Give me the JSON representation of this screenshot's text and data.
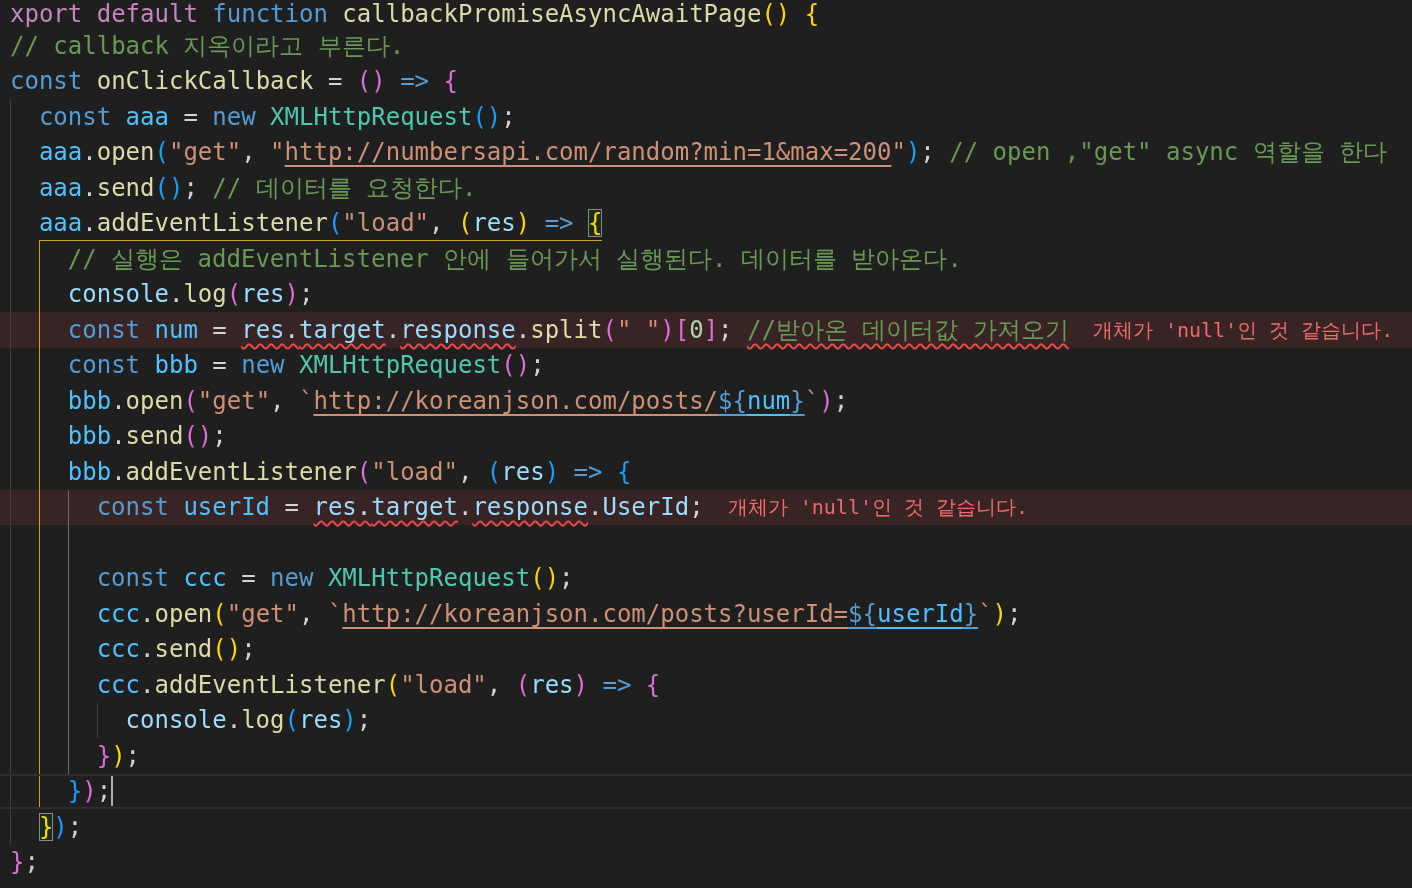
{
  "editor": {
    "lines": [
      {
        "kind": "code",
        "current": false,
        "error": false,
        "tokens": [
          {
            "text": "xport default ",
            "kind": "control"
          },
          {
            "text": "function ",
            "kind": "keyword"
          },
          {
            "text": "callbackPromiseAsyncAwaitPage",
            "kind": "function"
          },
          {
            "text": "() ",
            "kind": "bracket",
            "color": "#ffd700"
          },
          {
            "text": "{",
            "kind": "bracket",
            "color": "#ffd700"
          }
        ]
      },
      {
        "kind": "code",
        "current": false,
        "error": false,
        "tokens": [
          {
            "text": "// callback 지옥이라고 부른다.",
            "kind": "comment"
          }
        ]
      },
      {
        "kind": "code",
        "current": false,
        "error": false,
        "active_guide": false,
        "bracket_guide": false,
        "tokens": [
          {
            "text": "const ",
            "kind": "keyword"
          },
          {
            "text": "onClickCallback",
            "kind": "function"
          },
          {
            "text": " = ",
            "kind": "plain"
          },
          {
            "text": "() ",
            "kind": "bracket",
            "color": "#da70d6"
          },
          {
            "text": "=> ",
            "kind": "keyword"
          },
          {
            "text": "{",
            "kind": "bracket",
            "color": "#da70d6"
          }
        ],
        "children": [
          {
            "kind": "code",
            "current": false,
            "error": false,
            "tokens": [
              {
                "text": "const ",
                "kind": "keyword"
              },
              {
                "text": "aaa",
                "kind": "constant"
              },
              {
                "text": " = ",
                "kind": "plain"
              },
              {
                "text": "new ",
                "kind": "keyword"
              },
              {
                "text": "XMLHttpRequest",
                "kind": "class"
              },
              {
                "text": "()",
                "kind": "bracket",
                "color": "#179fff"
              },
              {
                "text": ";",
                "kind": "plain"
              }
            ]
          },
          {
            "kind": "code",
            "current": false,
            "error": false,
            "tokens": [
              {
                "text": "aaa",
                "kind": "constant"
              },
              {
                "text": ".",
                "kind": "plain"
              },
              {
                "text": "open",
                "kind": "function"
              },
              {
                "text": "(",
                "kind": "bracket",
                "color": "#179fff"
              },
              {
                "text": "\"get\"",
                "kind": "string"
              },
              {
                "text": ", ",
                "kind": "plain"
              },
              {
                "text": "\"",
                "kind": "string"
              },
              {
                "text": "http://numbersapi.com/random?min=1&max=200",
                "kind": "string",
                "link": true
              },
              {
                "text": "\"",
                "kind": "string"
              },
              {
                "text": ")",
                "kind": "bracket",
                "color": "#179fff"
              },
              {
                "text": "; ",
                "kind": "plain"
              },
              {
                "text": "// open ,\"get\" async 역할을 한다",
                "kind": "comment"
              }
            ]
          },
          {
            "kind": "code",
            "current": false,
            "error": false,
            "tokens": [
              {
                "text": "aaa",
                "kind": "constant"
              },
              {
                "text": ".",
                "kind": "plain"
              },
              {
                "text": "send",
                "kind": "function"
              },
              {
                "text": "()",
                "kind": "bracket",
                "color": "#179fff"
              },
              {
                "text": "; ",
                "kind": "plain"
              },
              {
                "text": "// 데이터를 요청한다.",
                "kind": "comment"
              }
            ]
          },
          {
            "kind": "code",
            "current": false,
            "error": false,
            "active_guide": false,
            "bracket_guide": true,
            "tokens": [
              {
                "text": "aaa",
                "kind": "constant"
              },
              {
                "text": ".",
                "kind": "plain"
              },
              {
                "text": "addEventListener",
                "kind": "function"
              },
              {
                "text": "(",
                "kind": "bracket",
                "color": "#179fff"
              },
              {
                "text": "\"load\"",
                "kind": "string"
              },
              {
                "text": ", ",
                "kind": "plain"
              },
              {
                "text": "(",
                "kind": "bracket",
                "color": "#ffd700"
              },
              {
                "text": "res",
                "kind": "variable"
              },
              {
                "text": ") ",
                "kind": "bracket",
                "color": "#ffd700"
              },
              {
                "text": "=> ",
                "kind": "keyword"
              },
              {
                "text": "{",
                "kind": "bracket",
                "color": "#ffd700",
                "matched": true
              }
            ],
            "children": [
              {
                "kind": "code",
                "current": false,
                "error": false,
                "tokens": [
                  {
                    "text": "// 실행은 addEventListener 안에 들어가서 실행된다. 데이터를 받아온다.",
                    "kind": "comment"
                  }
                ]
              },
              {
                "kind": "code",
                "current": false,
                "error": false,
                "tokens": [
                  {
                    "text": "console",
                    "kind": "variable"
                  },
                  {
                    "text": ".",
                    "kind": "plain"
                  },
                  {
                    "text": "log",
                    "kind": "function"
                  },
                  {
                    "text": "(",
                    "kind": "bracket",
                    "color": "#da70d6"
                  },
                  {
                    "text": "res",
                    "kind": "variable"
                  },
                  {
                    "text": ")",
                    "kind": "bracket",
                    "color": "#da70d6"
                  },
                  {
                    "text": ";",
                    "kind": "plain"
                  }
                ]
              },
              {
                "kind": "code",
                "current": false,
                "error": true,
                "message": "개체가 'null'인 것 같습니다.",
                "tokens": [
                  {
                    "text": "const ",
                    "kind": "keyword"
                  },
                  {
                    "text": "num",
                    "kind": "constant"
                  },
                  {
                    "text": " = ",
                    "kind": "plain"
                  },
                  {
                    "text": "res",
                    "kind": "variable",
                    "squiggle": true
                  },
                  {
                    "text": ".",
                    "kind": "plain",
                    "squiggle": true
                  },
                  {
                    "text": "target",
                    "kind": "variable",
                    "squiggle": true
                  },
                  {
                    "text": ".",
                    "kind": "plain"
                  },
                  {
                    "text": "response",
                    "kind": "variable",
                    "squiggle": true
                  },
                  {
                    "text": ".",
                    "kind": "plain"
                  },
                  {
                    "text": "split",
                    "kind": "function"
                  },
                  {
                    "text": "(",
                    "kind": "bracket",
                    "color": "#da70d6"
                  },
                  {
                    "text": "\" \"",
                    "kind": "string"
                  },
                  {
                    "text": ")",
                    "kind": "bracket",
                    "color": "#da70d6"
                  },
                  {
                    "text": "[",
                    "kind": "bracket",
                    "color": "#da70d6"
                  },
                  {
                    "text": "0",
                    "kind": "number"
                  },
                  {
                    "text": "]",
                    "kind": "bracket",
                    "color": "#da70d6"
                  },
                  {
                    "text": "; ",
                    "kind": "plain"
                  },
                  {
                    "text": "//받아온 데이터값 가져오기",
                    "kind": "comment",
                    "squiggle": true
                  }
                ]
              },
              {
                "kind": "code",
                "current": false,
                "error": false,
                "tokens": [
                  {
                    "text": "const ",
                    "kind": "keyword"
                  },
                  {
                    "text": "bbb",
                    "kind": "constant"
                  },
                  {
                    "text": " = ",
                    "kind": "plain"
                  },
                  {
                    "text": "new ",
                    "kind": "keyword"
                  },
                  {
                    "text": "XMLHttpRequest",
                    "kind": "class"
                  },
                  {
                    "text": "()",
                    "kind": "bracket",
                    "color": "#da70d6"
                  },
                  {
                    "text": ";",
                    "kind": "plain"
                  }
                ]
              },
              {
                "kind": "code",
                "current": false,
                "error": false,
                "tokens": [
                  {
                    "text": "bbb",
                    "kind": "constant"
                  },
                  {
                    "text": ".",
                    "kind": "plain"
                  },
                  {
                    "text": "open",
                    "kind": "function"
                  },
                  {
                    "text": "(",
                    "kind": "bracket",
                    "color": "#da70d6"
                  },
                  {
                    "text": "\"get\"",
                    "kind": "string"
                  },
                  {
                    "text": ", ",
                    "kind": "plain"
                  },
                  {
                    "text": "`",
                    "kind": "string"
                  },
                  {
                    "text": "http://koreanjson.com/posts/",
                    "kind": "string",
                    "link": true
                  },
                  {
                    "text": "${",
                    "kind": "keyword",
                    "link": true
                  },
                  {
                    "text": "num",
                    "kind": "constant",
                    "link": true
                  },
                  {
                    "text": "}",
                    "kind": "keyword",
                    "link": true
                  },
                  {
                    "text": "`",
                    "kind": "string"
                  },
                  {
                    "text": ")",
                    "kind": "bracket",
                    "color": "#da70d6"
                  },
                  {
                    "text": ";",
                    "kind": "plain"
                  }
                ]
              },
              {
                "kind": "code",
                "current": false,
                "error": false,
                "tokens": [
                  {
                    "text": "bbb",
                    "kind": "constant"
                  },
                  {
                    "text": ".",
                    "kind": "plain"
                  },
                  {
                    "text": "send",
                    "kind": "function"
                  },
                  {
                    "text": "()",
                    "kind": "bracket",
                    "color": "#da70d6"
                  },
                  {
                    "text": ";",
                    "kind": "plain"
                  }
                ]
              },
              {
                "kind": "code",
                "current": false,
                "error": false,
                "active_guide": true,
                "bracket_guide": false,
                "tokens": [
                  {
                    "text": "bbb",
                    "kind": "constant"
                  },
                  {
                    "text": ".",
                    "kind": "plain"
                  },
                  {
                    "text": "addEventListener",
                    "kind": "function"
                  },
                  {
                    "text": "(",
                    "kind": "bracket",
                    "color": "#da70d6"
                  },
                  {
                    "text": "\"load\"",
                    "kind": "string"
                  },
                  {
                    "text": ", ",
                    "kind": "plain"
                  },
                  {
                    "text": "(",
                    "kind": "bracket",
                    "color": "#179fff"
                  },
                  {
                    "text": "res",
                    "kind": "variable"
                  },
                  {
                    "text": ") ",
                    "kind": "bracket",
                    "color": "#179fff"
                  },
                  {
                    "text": "=> ",
                    "kind": "keyword"
                  },
                  {
                    "text": "{",
                    "kind": "bracket",
                    "color": "#179fff"
                  }
                ],
                "children": [
                  {
                    "kind": "code",
                    "current": false,
                    "error": true,
                    "message": "개체가 'null'인 것 같습니다.",
                    "tokens": [
                      {
                        "text": "const ",
                        "kind": "keyword"
                      },
                      {
                        "text": "userId",
                        "kind": "constant"
                      },
                      {
                        "text": " = ",
                        "kind": "plain"
                      },
                      {
                        "text": "res",
                        "kind": "variable",
                        "squiggle": true
                      },
                      {
                        "text": ".",
                        "kind": "plain",
                        "squiggle": true
                      },
                      {
                        "text": "target",
                        "kind": "variable",
                        "squiggle": true
                      },
                      {
                        "text": ".",
                        "kind": "plain"
                      },
                      {
                        "text": "response",
                        "kind": "variable",
                        "squiggle": true
                      },
                      {
                        "text": ".",
                        "kind": "plain"
                      },
                      {
                        "text": "UserId",
                        "kind": "variable"
                      },
                      {
                        "text": ";",
                        "kind": "plain"
                      }
                    ]
                  },
                  {
                    "kind": "blank",
                    "current": false,
                    "error": false
                  },
                  {
                    "kind": "code",
                    "current": false,
                    "error": false,
                    "tokens": [
                      {
                        "text": "const ",
                        "kind": "keyword"
                      },
                      {
                        "text": "ccc",
                        "kind": "constant"
                      },
                      {
                        "text": " = ",
                        "kind": "plain"
                      },
                      {
                        "text": "new ",
                        "kind": "keyword"
                      },
                      {
                        "text": "XMLHttpRequest",
                        "kind": "class"
                      },
                      {
                        "text": "()",
                        "kind": "bracket",
                        "color": "#ffd700"
                      },
                      {
                        "text": ";",
                        "kind": "plain"
                      }
                    ]
                  },
                  {
                    "kind": "code",
                    "current": false,
                    "error": false,
                    "tokens": [
                      {
                        "text": "ccc",
                        "kind": "constant"
                      },
                      {
                        "text": ".",
                        "kind": "plain"
                      },
                      {
                        "text": "open",
                        "kind": "function"
                      },
                      {
                        "text": "(",
                        "kind": "bracket",
                        "color": "#ffd700"
                      },
                      {
                        "text": "\"get\"",
                        "kind": "string"
                      },
                      {
                        "text": ", ",
                        "kind": "plain"
                      },
                      {
                        "text": "`",
                        "kind": "string"
                      },
                      {
                        "text": "http://koreanjson.com/posts?userId=",
                        "kind": "string",
                        "link": true
                      },
                      {
                        "text": "${",
                        "kind": "keyword",
                        "link": true
                      },
                      {
                        "text": "userId",
                        "kind": "constant",
                        "link": true
                      },
                      {
                        "text": "}",
                        "kind": "keyword",
                        "link": true
                      },
                      {
                        "text": "`",
                        "kind": "string"
                      },
                      {
                        "text": ")",
                        "kind": "bracket",
                        "color": "#ffd700"
                      },
                      {
                        "text": ";",
                        "kind": "plain"
                      }
                    ]
                  },
                  {
                    "kind": "code",
                    "current": false,
                    "error": false,
                    "tokens": [
                      {
                        "text": "ccc",
                        "kind": "constant"
                      },
                      {
                        "text": ".",
                        "kind": "plain"
                      },
                      {
                        "text": "send",
                        "kind": "function"
                      },
                      {
                        "text": "()",
                        "kind": "bracket",
                        "color": "#ffd700"
                      },
                      {
                        "text": ";",
                        "kind": "plain"
                      }
                    ]
                  },
                  {
                    "kind": "code",
                    "current": false,
                    "error": false,
                    "active_guide": false,
                    "bracket_guide": false,
                    "tokens": [
                      {
                        "text": "ccc",
                        "kind": "constant"
                      },
                      {
                        "text": ".",
                        "kind": "plain"
                      },
                      {
                        "text": "addEventListener",
                        "kind": "function"
                      },
                      {
                        "text": "(",
                        "kind": "bracket",
                        "color": "#ffd700"
                      },
                      {
                        "text": "\"load\"",
                        "kind": "string"
                      },
                      {
                        "text": ", ",
                        "kind": "plain"
                      },
                      {
                        "text": "(",
                        "kind": "bracket",
                        "color": "#da70d6"
                      },
                      {
                        "text": "res",
                        "kind": "variable"
                      },
                      {
                        "text": ") ",
                        "kind": "bracket",
                        "color": "#da70d6"
                      },
                      {
                        "text": "=> ",
                        "kind": "keyword"
                      },
                      {
                        "text": "{",
                        "kind": "bracket",
                        "color": "#da70d6"
                      }
                    ],
                    "children": [
                      {
                        "kind": "code",
                        "current": false,
                        "error": false,
                        "tokens": [
                          {
                            "text": "console",
                            "kind": "variable"
                          },
                          {
                            "text": ".",
                            "kind": "plain"
                          },
                          {
                            "text": "log",
                            "kind": "function"
                          },
                          {
                            "text": "(",
                            "kind": "bracket",
                            "color": "#179fff"
                          },
                          {
                            "text": "res",
                            "kind": "variable"
                          },
                          {
                            "text": ")",
                            "kind": "bracket",
                            "color": "#179fff"
                          },
                          {
                            "text": ";",
                            "kind": "plain"
                          }
                        ]
                      }
                    ]
                  },
                  {
                    "kind": "code",
                    "current": false,
                    "error": false,
                    "tokens": [
                      {
                        "text": "}",
                        "kind": "bracket",
                        "color": "#da70d6"
                      },
                      {
                        "text": ")",
                        "kind": "bracket",
                        "color": "#ffd700"
                      },
                      {
                        "text": ";",
                        "kind": "plain"
                      }
                    ]
                  }
                ]
              },
              {
                "kind": "code",
                "current": true,
                "error": false,
                "tokens": [
                  {
                    "text": "}",
                    "kind": "bracket",
                    "color": "#179fff"
                  },
                  {
                    "text": ")",
                    "kind": "bracket",
                    "color": "#da70d6"
                  },
                  {
                    "text": ";",
                    "kind": "plain"
                  }
                ]
              }
            ]
          },
          {
            "kind": "code",
            "current": false,
            "error": false,
            "tokens": [
              {
                "text": "}",
                "kind": "bracket",
                "color": "#ffd700",
                "matched": true
              },
              {
                "text": ")",
                "kind": "bracket",
                "color": "#179fff"
              },
              {
                "text": ";",
                "kind": "plain"
              }
            ]
          }
        ]
      },
      {
        "kind": "code",
        "current": false,
        "error": false,
        "tokens": [
          {
            "text": "}",
            "kind": "bracket",
            "color": "#da70d6"
          },
          {
            "text": ";",
            "kind": "plain"
          }
        ]
      }
    ]
  }
}
